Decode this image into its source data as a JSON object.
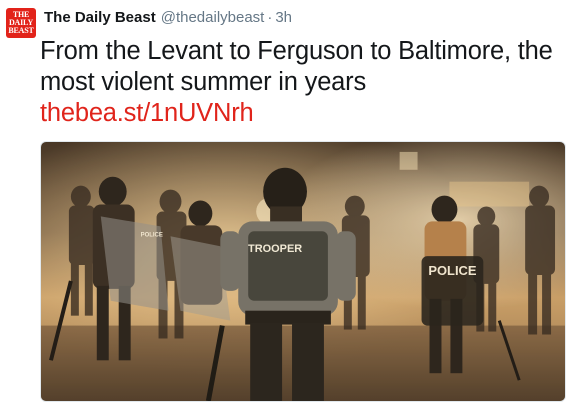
{
  "tweet": {
    "avatar_text": "THE DAILY BEAST",
    "author_name": "The Daily Beast",
    "handle": "@thedailybeast",
    "separator": "·",
    "time": "3h",
    "text": "From the Levant to Ferguson to Baltimore, the most violent summer in years",
    "link": "thebea.st/1nUVNrh",
    "link_color": "#e0241b"
  },
  "photo": {
    "trooper_label": "TROOPER",
    "police_label": "POLICE",
    "shield_label": "POLICE",
    "brand_color": "#e2231a"
  }
}
